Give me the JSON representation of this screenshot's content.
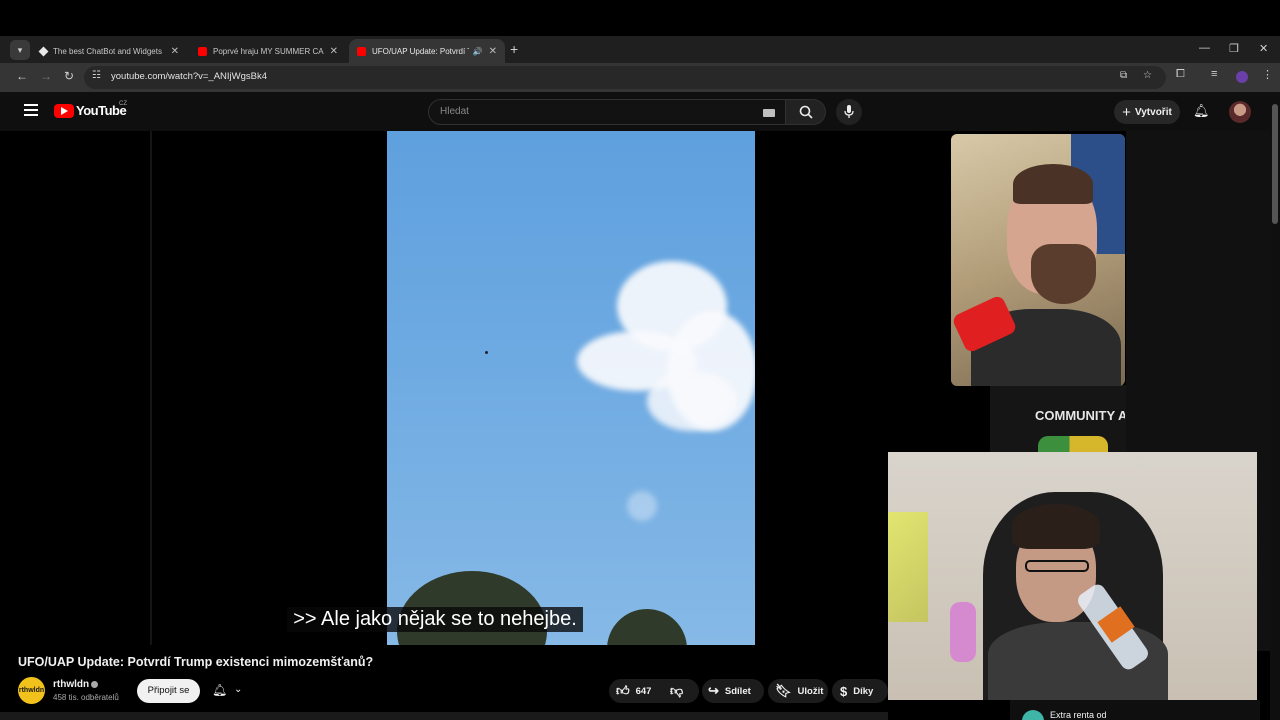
{
  "browser": {
    "tabs": [
      {
        "title": "The best ChatBot and Widgets",
        "favicon": "diamond-favicon",
        "active": false
      },
      {
        "title": "Poprvé hraju MY SUMMER CAR",
        "favicon": "youtube-favicon",
        "active": false
      },
      {
        "title": "UFO/UAP Update: Potvrdí Tr",
        "favicon": "youtube-favicon",
        "active": true
      }
    ],
    "url": "youtube.com/watch?v=_ANIjWgsBk4"
  },
  "youtube": {
    "logo_text": "YouTube",
    "country": "CZ",
    "search_placeholder": "Hledat",
    "create_label": "Vytvořit"
  },
  "video": {
    "subtitle": ">> Ale jako nějak se to nehejbe.",
    "title": "UFO/UAP Update: Potvrdí Trump existenci mimozemšťanů?"
  },
  "channel": {
    "avatar_text": "rthwldn",
    "name": "rthwldn",
    "subscribers": "458 tis. odběratelů",
    "join_label": "Připojit se"
  },
  "actions": {
    "likes": "647",
    "share": "Sdílet",
    "save": "Uložit",
    "thanks": "Díky"
  },
  "sidebar": {
    "community": "COMMUNITY A",
    "extra": "Extra renta od"
  },
  "colors": {
    "yt_red": "#ff0000",
    "chrome_bg": "#353535",
    "page_bg": "#0f0f0f"
  }
}
